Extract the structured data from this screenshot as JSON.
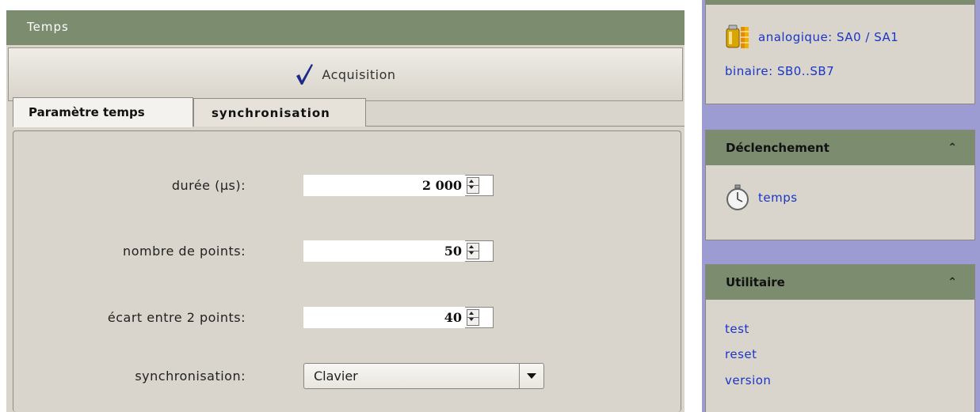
{
  "left_panel": {
    "title": "Temps",
    "acquisition_label": "Acquisition",
    "tabs": [
      {
        "label": "Paramètre temps",
        "active": true
      },
      {
        "label": "synchronisation",
        "active": false
      }
    ],
    "fields": {
      "duree": {
        "label": "durée (µs):",
        "value": "2 000"
      },
      "nombre": {
        "label": "nombre de points:",
        "value": "50"
      },
      "ecart": {
        "label": "écart entre 2 points:",
        "value": "40"
      },
      "sync": {
        "label": "synchronisation:",
        "selected": "Clavier"
      }
    }
  },
  "right_panel": {
    "sources": {
      "analog_link": "analogique: SA0 / SA1",
      "binary_link": "binaire: SB0..SB7"
    },
    "declenchement": {
      "title": "Déclenchement",
      "items": [
        "temps"
      ]
    },
    "utilitaire": {
      "title": "Utilitaire",
      "items": [
        "test",
        "reset",
        "version"
      ]
    }
  },
  "colors": {
    "header_green": "#7c8c6f",
    "panel_bg": "#d9d5cc",
    "sidebar_bg": "#9c9bd2",
    "link_blue": "#1a35c8"
  }
}
